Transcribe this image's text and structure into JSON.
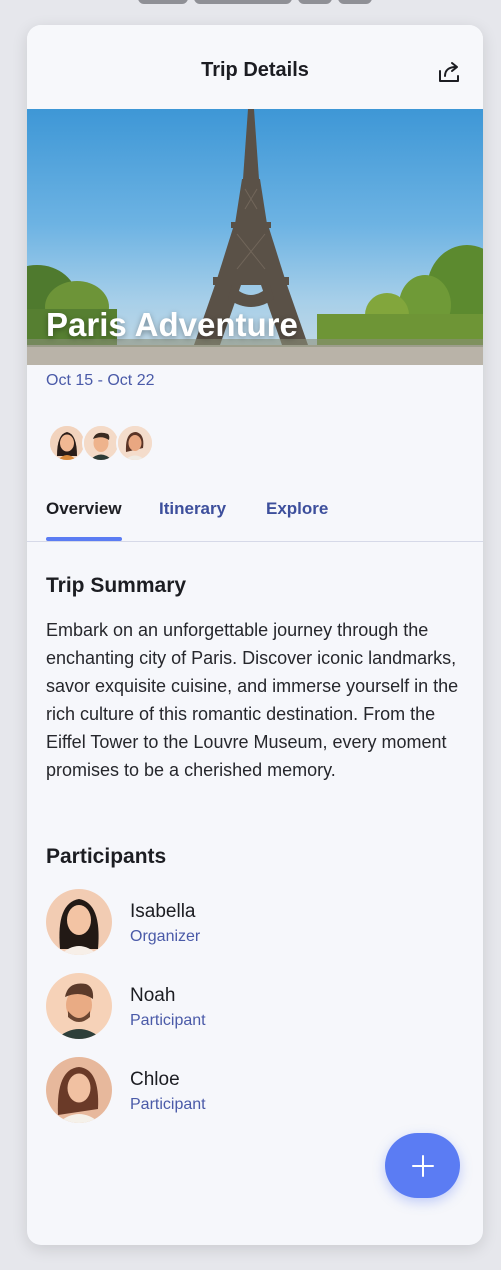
{
  "header": {
    "title": "Trip Details",
    "share_icon": "share-icon"
  },
  "trip": {
    "name": "Paris Adventure",
    "dates": "Oct 15 - Oct 22"
  },
  "tabs": [
    {
      "label": "Overview",
      "active": true
    },
    {
      "label": "Itinerary",
      "active": false
    },
    {
      "label": "Explore",
      "active": false
    }
  ],
  "summary": {
    "title": "Trip Summary",
    "text": "Embark on an unforgettable journey through the enchanting city of Paris. Discover iconic landmarks, savor exquisite cuisine, and immerse yourself in the rich culture of this romantic destination. From the Eiffel Tower to the Louvre Museum, every moment promises to be a cherished memory."
  },
  "participants": {
    "title": "Participants",
    "items": [
      {
        "name": "Isabella",
        "role": "Organizer"
      },
      {
        "name": "Noah",
        "role": "Participant"
      },
      {
        "name": "Chloe",
        "role": "Participant"
      }
    ]
  },
  "fab": {
    "icon": "plus-icon"
  },
  "colors": {
    "accent": "#5b7cf3",
    "secondary_text": "#4a5aa8",
    "background": "#f6f7fb"
  }
}
